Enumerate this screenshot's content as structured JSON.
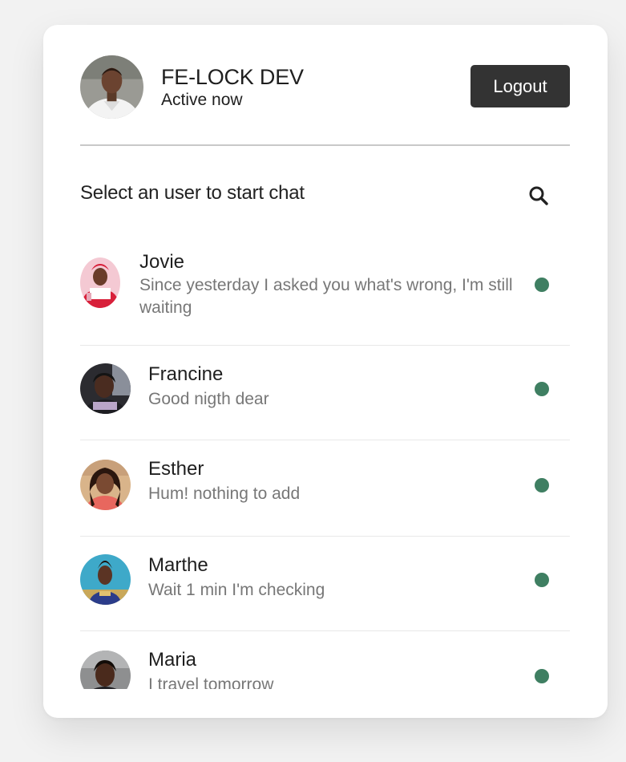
{
  "header": {
    "name": "FE-LOCK DEV",
    "status": "Active now",
    "logout_label": "Logout",
    "avatar_icon": "avatar-icon"
  },
  "search": {
    "label": "Select an user to start chat",
    "icon": "search-icon"
  },
  "colors": {
    "online_dot": "#3f7f62",
    "logout_bg": "#333333"
  },
  "users": [
    {
      "name": "Jovie",
      "message": "Since yesterday I asked you what's wrong, I'm still waiting",
      "status": "online"
    },
    {
      "name": "Francine",
      "message": "Good nigth dear",
      "status": "online"
    },
    {
      "name": "Esther",
      "message": "Hum! nothing to add",
      "status": "online"
    },
    {
      "name": "Marthe",
      "message": "Wait 1 min I'm checking",
      "status": "online"
    },
    {
      "name": "Maria",
      "message": "I travel tomorrow",
      "status": "online"
    }
  ]
}
